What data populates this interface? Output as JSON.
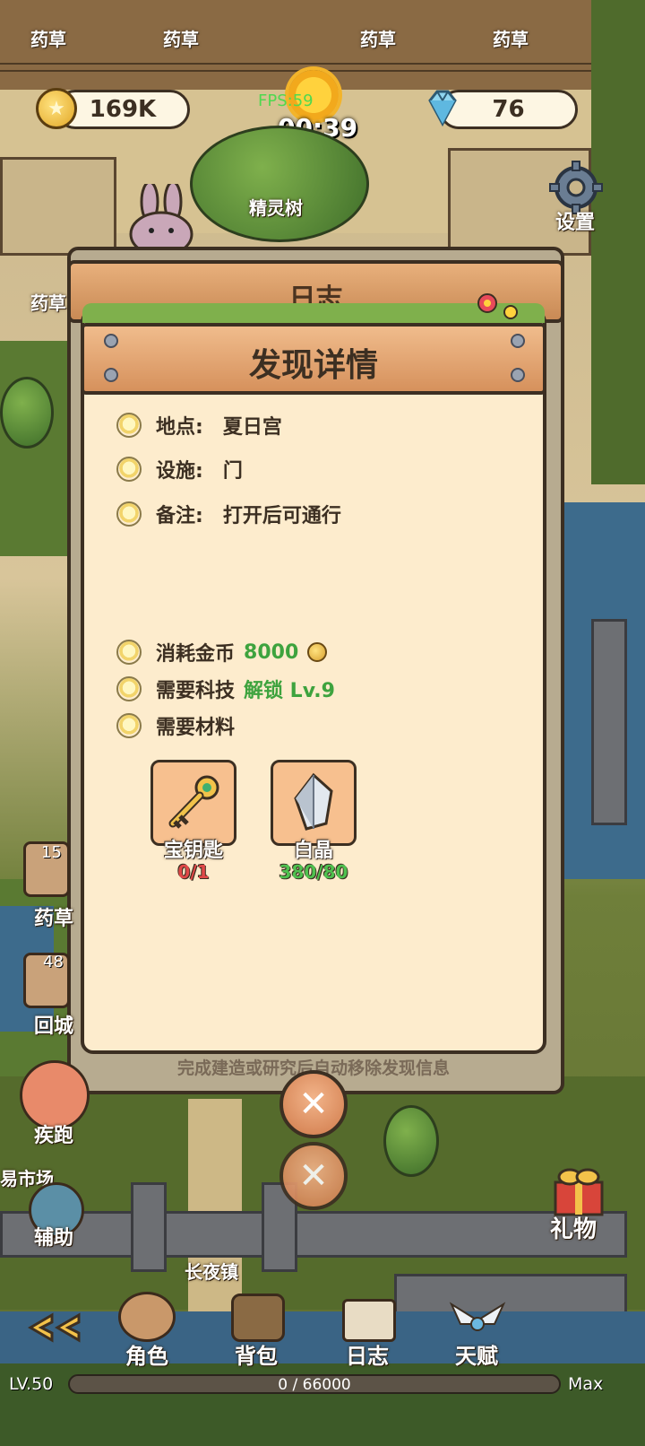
{
  "hud": {
    "coins": "169K",
    "gems": "76",
    "timer": "00:39",
    "fps": "FPS:59"
  },
  "map": {
    "herb_labels": [
      "药草",
      "药草",
      "药草",
      "药草",
      "药草"
    ],
    "spirit_tree": "精灵树",
    "settings": "设置",
    "town": "长夜镇"
  },
  "back_panel": {
    "title": "日志"
  },
  "dialog": {
    "title": "发现详情",
    "location_label": "地点:",
    "location_value": "夏日宫",
    "facility_label": "设施:",
    "facility_value": "门",
    "note_label": "备注:",
    "note_value": "打开后可通行",
    "cost_label": "消耗金币",
    "cost_value": "8000",
    "tech_label": "需要科技",
    "tech_value": "解锁 Lv.9",
    "materials_label": "需要材料",
    "materials": [
      {
        "name": "宝钥匙",
        "count": "0/1",
        "color": "#e04848",
        "icon": "key-icon"
      },
      {
        "name": "白晶",
        "count": "380/80",
        "color": "#4fc14f",
        "icon": "crystal-icon"
      }
    ],
    "hint": "完成建造或研究后自动移除发现信息"
  },
  "side": {
    "herb_count": "15",
    "herb_label": "药草",
    "return_count": "48",
    "return_label": "回城",
    "sprint": "疾跑",
    "market": "易市场",
    "assist": "辅助",
    "gift": "礼物"
  },
  "nav": {
    "character": "角色",
    "bag": "背包",
    "log": "日志",
    "talent": "天赋"
  },
  "level": {
    "lv": "LV.50",
    "exp": "0 / 66000",
    "max": "Max"
  },
  "colors": {
    "panel_bg": "#fdeccd",
    "banner": "#e0a070",
    "success": "#4fc14f",
    "danger": "#e04848",
    "outline": "#3c2f22"
  }
}
